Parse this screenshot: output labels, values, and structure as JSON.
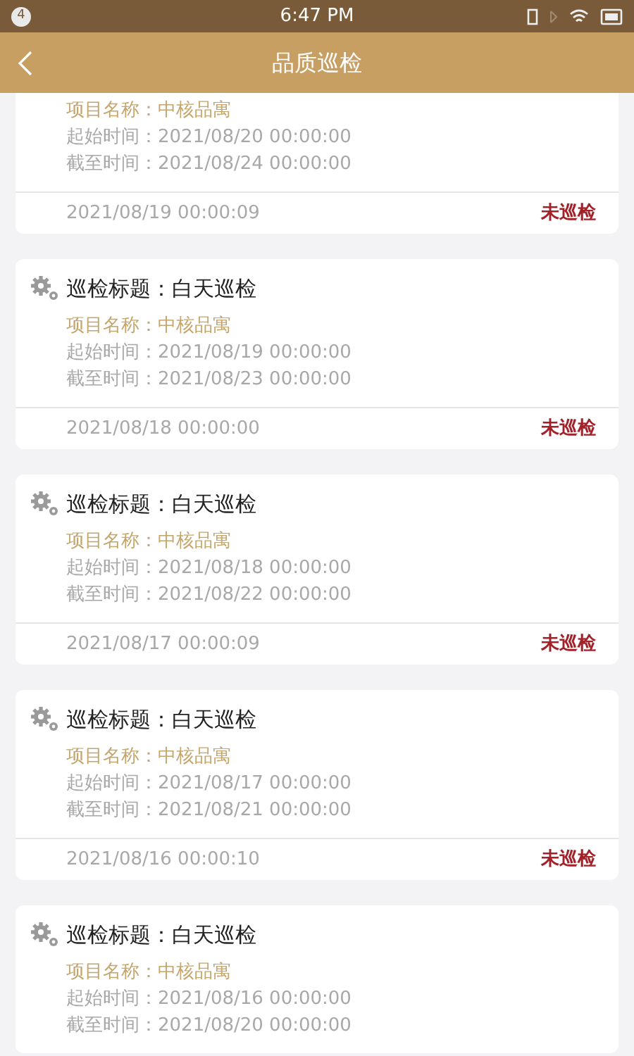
{
  "status_bar": {
    "badge": "4",
    "time": "6:47 PM"
  },
  "header": {
    "title": "品质巡检"
  },
  "cards": [
    {
      "project": "项目名称：中核品寓",
      "start": "起始时间：2021/08/20 00:00:00",
      "end": "截至时间：2021/08/24 00:00:00",
      "created": "2021/08/19 00:00:09",
      "status": "未巡检"
    },
    {
      "title": "巡检标题：白天巡检",
      "project": "项目名称：中核品寓",
      "start": "起始时间：2021/08/19 00:00:00",
      "end": "截至时间：2021/08/23 00:00:00",
      "created": "2021/08/18 00:00:00",
      "status": "未巡检"
    },
    {
      "title": "巡检标题：白天巡检",
      "project": "项目名称：中核品寓",
      "start": "起始时间：2021/08/18 00:00:00",
      "end": "截至时间：2021/08/22 00:00:00",
      "created": "2021/08/17 00:00:09",
      "status": "未巡检"
    },
    {
      "title": "巡检标题：白天巡检",
      "project": "项目名称：中核品寓",
      "start": "起始时间：2021/08/17 00:00:00",
      "end": "截至时间：2021/08/21 00:00:00",
      "created": "2021/08/16 00:00:10",
      "status": "未巡检"
    },
    {
      "title": "巡检标题：白天巡检",
      "project": "项目名称：中核品寓",
      "start": "起始时间：2021/08/16 00:00:00",
      "end": "截至时间：2021/08/20 00:00:00"
    }
  ]
}
